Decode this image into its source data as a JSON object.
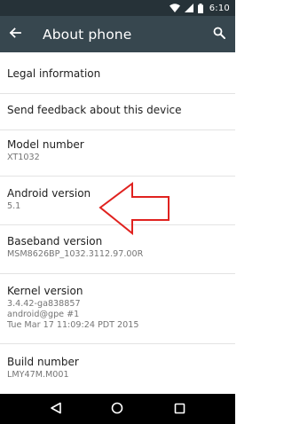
{
  "status_bar": {
    "time": "6:10"
  },
  "app_bar": {
    "title": "About phone"
  },
  "items": [
    {
      "title": "Legal information",
      "subtitle": ""
    },
    {
      "title": "Send feedback about this device",
      "subtitle": ""
    },
    {
      "title": "Model number",
      "subtitle": "XT1032"
    },
    {
      "title": "Android version",
      "subtitle": "5.1"
    },
    {
      "title": "Baseband version",
      "subtitle": "MSM8626BP_1032.3112.97.00R"
    },
    {
      "title": "Kernel version",
      "subtitle_lines": [
        "3.4.42-ga838857",
        "android@gpe #1",
        "Tue Mar 17 11:09:24 PDT 2015"
      ]
    },
    {
      "title": "Build number",
      "subtitle": "LMY47M.M001"
    }
  ],
  "colors": {
    "status_bar": "#263238",
    "app_bar": "#37474f",
    "annotation_arrow": "#e0221f"
  },
  "icons": {
    "status": [
      "wifi-icon",
      "cell-signal-icon",
      "battery-icon"
    ],
    "app_bar": [
      "back-arrow-icon",
      "search-icon"
    ],
    "navigation": [
      "back-triangle-icon",
      "home-circle-icon",
      "recents-square-icon"
    ]
  }
}
